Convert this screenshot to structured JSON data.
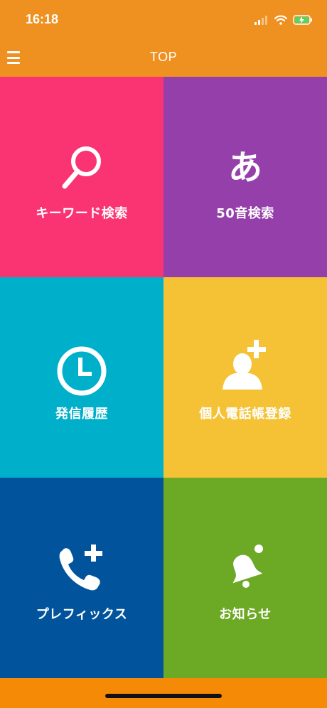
{
  "status_bar": {
    "time": "16:18",
    "icons": [
      "signal-icon",
      "wifi-icon",
      "battery-charging-icon"
    ]
  },
  "nav": {
    "title": "TOP",
    "menu_icon": "hamburger-menu-icon"
  },
  "tiles": [
    {
      "label": "キーワード検索",
      "icon": "search-icon",
      "color": "#fa3473"
    },
    {
      "label": "50音検索",
      "icon": "hiragana-a-icon",
      "icon_char": "あ",
      "color": "#953fab"
    },
    {
      "label": "発信履歴",
      "icon": "clock-icon",
      "color": "#00afca"
    },
    {
      "label": "個人電話帳登録",
      "icon": "add-person-icon",
      "color": "#f4c234"
    },
    {
      "label": "プレフィックス",
      "icon": "add-phone-icon",
      "color": "#01549c"
    },
    {
      "label": "お知らせ",
      "icon": "bell-icon",
      "color": "#6ca925"
    }
  ],
  "colors": {
    "header": "#ef9120",
    "bottom_bar": "#f58a07"
  }
}
